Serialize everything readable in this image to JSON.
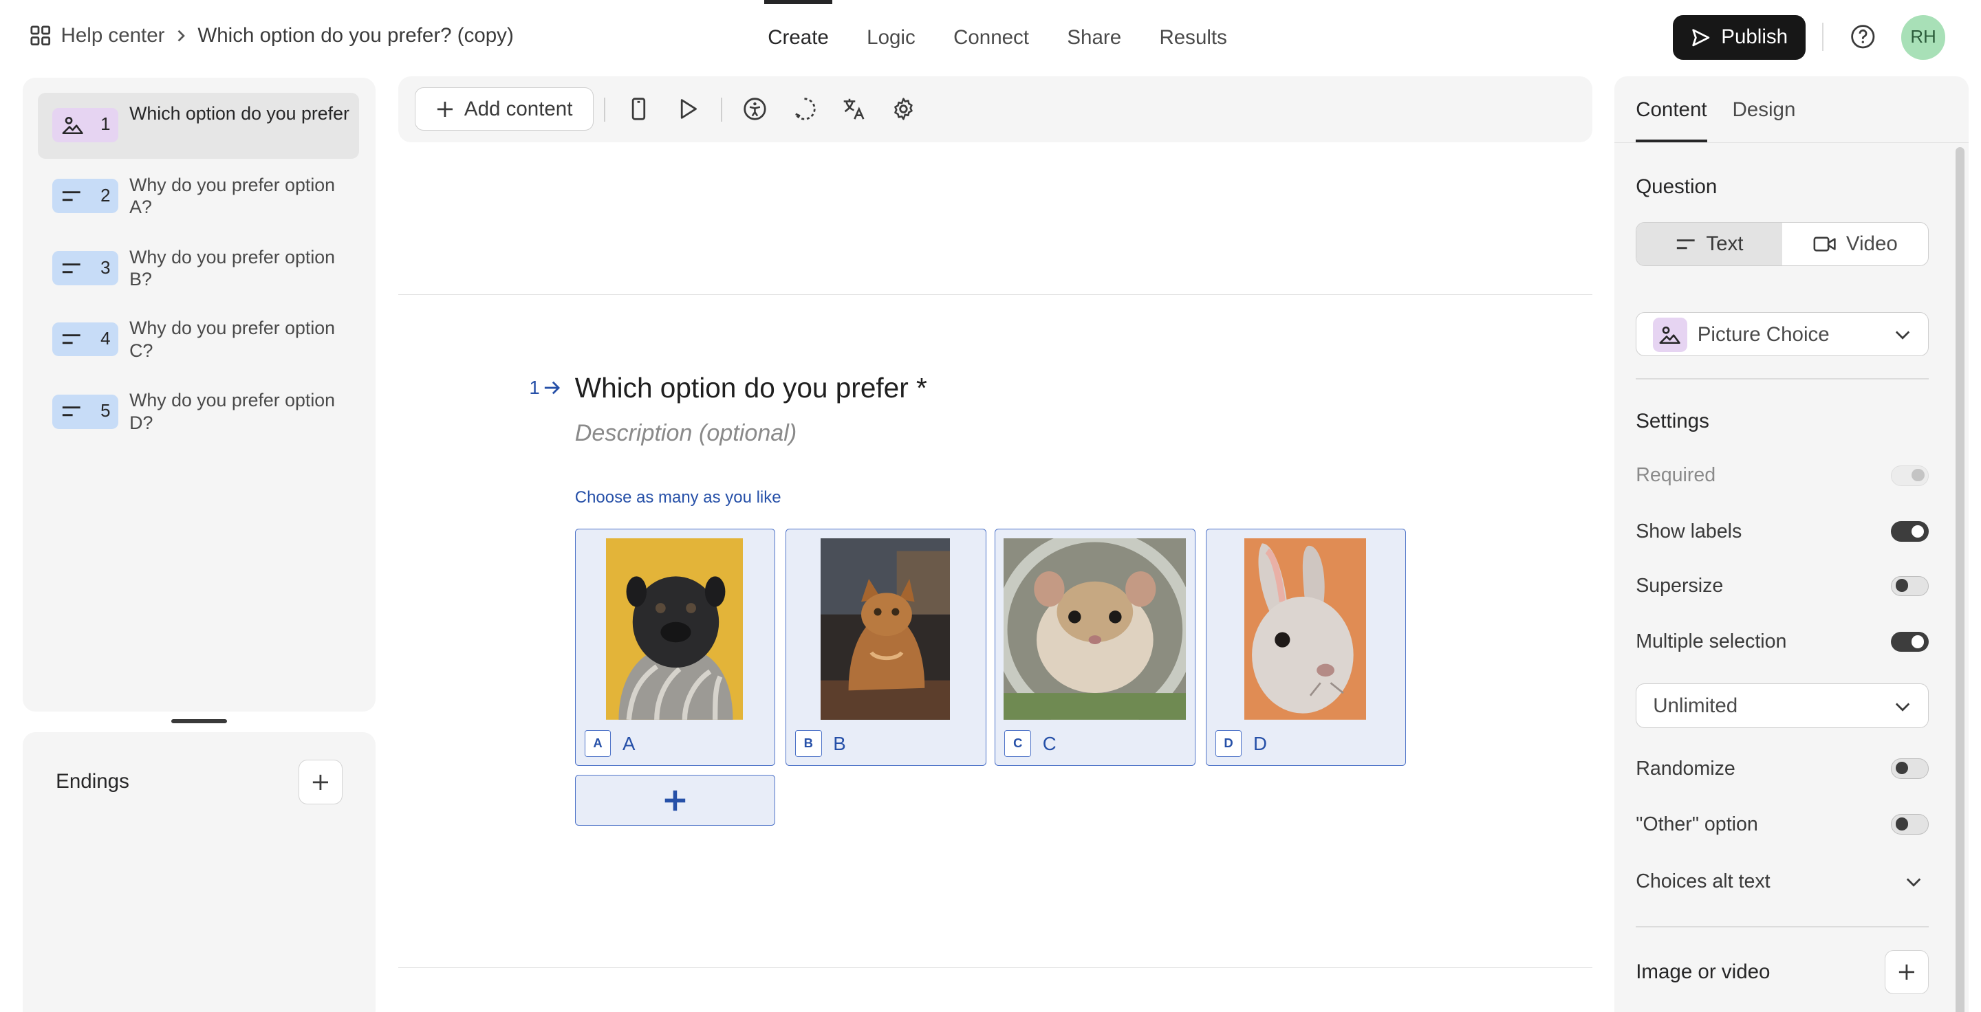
{
  "breadcrumb": {
    "root": "Help center",
    "current": "Which option do you prefer? (copy)"
  },
  "nav_tabs": [
    "Create",
    "Logic",
    "Connect",
    "Share",
    "Results"
  ],
  "publish_label": "Publish",
  "avatar_initials": "RH",
  "questions": [
    {
      "num": "1",
      "label": "Which option do you prefer",
      "type": "picture-choice"
    },
    {
      "num": "2",
      "label": "Why do you prefer option A?",
      "type": "text"
    },
    {
      "num": "3",
      "label": "Why do you prefer option B?",
      "type": "text"
    },
    {
      "num": "4",
      "label": "Why do you prefer option C?",
      "type": "text"
    },
    {
      "num": "5",
      "label": "Why do you prefer option D?",
      "type": "text"
    }
  ],
  "endings_label": "Endings",
  "toolbar": {
    "add_content": "Add content"
  },
  "question": {
    "number": "1",
    "title": "Which option do you prefer *",
    "description_placeholder": "Description (optional)",
    "hint": "Choose as many as you like",
    "choices": [
      {
        "key": "A",
        "label": "A",
        "image": "pug-photo"
      },
      {
        "key": "B",
        "label": "B",
        "image": "cat-photo"
      },
      {
        "key": "C",
        "label": "C",
        "image": "hamster-photo"
      },
      {
        "key": "D",
        "label": "D",
        "image": "rabbit-photo"
      }
    ]
  },
  "right_panel": {
    "tabs": [
      "Content",
      "Design"
    ],
    "question_section": "Question",
    "question_modes": [
      "Text",
      "Video"
    ],
    "question_type": "Picture Choice",
    "settings_section": "Settings",
    "settings": [
      {
        "label": "Required",
        "state": "disabled"
      },
      {
        "label": "Show labels",
        "state": "on"
      },
      {
        "label": "Supersize",
        "state": "off"
      },
      {
        "label": "Multiple selection",
        "state": "on"
      }
    ],
    "multiple_limit": "Unlimited",
    "settings2": [
      {
        "label": "Randomize",
        "state": "off"
      },
      {
        "label": "\"Other\" option",
        "state": "off"
      }
    ],
    "alt_text_label": "Choices alt text",
    "media_label": "Image or video"
  },
  "colors": {
    "accent": "#2650a8",
    "choice_bg": "#e8edf8",
    "publish_bg": "#171717",
    "avatar_bg": "#a8e0b7"
  }
}
